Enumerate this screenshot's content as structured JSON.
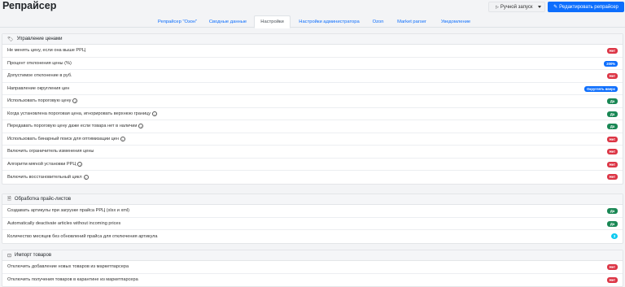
{
  "header": {
    "title": "Репрайсер",
    "manual_run": "Ручной запуск",
    "edit": "Редактировать репрайсер"
  },
  "tabs": [
    {
      "label": "Репрайсер \"Озон\""
    },
    {
      "label": "Сводные данные"
    },
    {
      "label": "Настройки"
    },
    {
      "label": "Настройки администратора"
    },
    {
      "label": "Ozon"
    },
    {
      "label": "Market parser"
    },
    {
      "label": "Уведомление"
    }
  ],
  "sections": [
    {
      "title": "Управление ценами",
      "rows": [
        {
          "label": "Не менять цену, если она выше РРЦ",
          "value": "Нет"
        },
        {
          "label": "Процент отклонения цены (%)",
          "value": "200%"
        },
        {
          "label": "Допустимое отклонение в руб.",
          "value": "Нет"
        },
        {
          "label": "Направление округления цен",
          "value": "Округлять вверх"
        },
        {
          "label": "Использовать пороговую цену",
          "value": "Да"
        },
        {
          "label": "Когда установлена пороговая цена, игнорировать верхнюю границу",
          "value": "Да"
        },
        {
          "label": "Передавать пороговую цену даже если товара нет в наличии",
          "value": "Да"
        },
        {
          "label": "Использовать бинарный поиск для оптимизации цен",
          "value": "Нет"
        },
        {
          "label": "Включить ограничитель изменения цены",
          "value": "Нет"
        },
        {
          "label": "Алгоритм мягкой установки РРЦ",
          "value": "Нет"
        },
        {
          "label": "Включить восстановительный цикл",
          "value": "Нет"
        }
      ]
    },
    {
      "title": "Обработка прайс-листов",
      "rows": [
        {
          "label": "Создавать артикулы при загрузке прайса РРЦ (xlsx и xml)",
          "value": "Да"
        },
        {
          "label": "Automatically deactivate articles without incoming prices",
          "value": "Да"
        },
        {
          "label": "Количество месяцев без обновлений прайса для отключения артикула",
          "value": "3"
        }
      ]
    },
    {
      "title": "Импорт товаров",
      "rows": [
        {
          "label": "Отключить добавление новых товаров из маркетпарсера",
          "value": "Нет"
        },
        {
          "label": "Отключить получения товаров в карантине из маркетпарсера",
          "value": "Нет"
        }
      ]
    }
  ]
}
